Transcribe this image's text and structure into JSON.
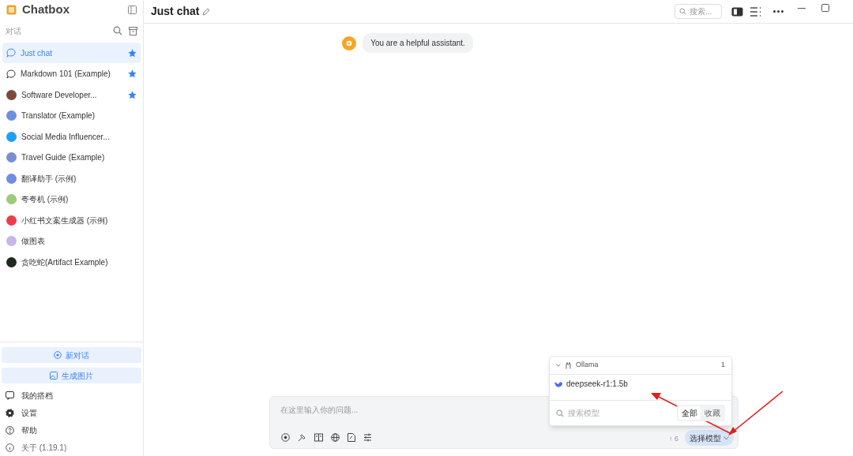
{
  "app": {
    "title": "Chatbox"
  },
  "sidebar": {
    "section_label": "对话",
    "items": [
      {
        "label": "Just chat",
        "kind": "chat",
        "selected": true,
        "starred": true
      },
      {
        "label": "Markdown 101 (Example)",
        "kind": "chat",
        "selected": false,
        "starred": true
      },
      {
        "label": "Software Developer...",
        "kind": "avatar",
        "color": "#7c4a3a",
        "selected": false,
        "starred": true
      },
      {
        "label": "Translator (Example)",
        "kind": "avatar",
        "color": "#6d8fe0",
        "selected": false,
        "starred": false
      },
      {
        "label": "Social Media Influencer...",
        "kind": "avatar",
        "color": "#1da1f2",
        "selected": false,
        "starred": false
      },
      {
        "label": "Travel Guide (Example)",
        "kind": "avatar",
        "color": "#7a8fd0",
        "selected": false,
        "starred": false
      },
      {
        "label": "翻译助手 (示例)",
        "kind": "avatar",
        "color": "#6d8fe0",
        "selected": false,
        "starred": false
      },
      {
        "label": "夸夸机 (示例)",
        "kind": "avatar",
        "color": "#9acd7a",
        "selected": false,
        "starred": false
      },
      {
        "label": "小红书文案生成器 (示例)",
        "kind": "avatar",
        "color": "#ef3b4b",
        "selected": false,
        "starred": false
      },
      {
        "label": "做图表",
        "kind": "avatar",
        "color": "#c7b6e8",
        "selected": false,
        "starred": false
      },
      {
        "label": "贪吃蛇(Artifact Example)",
        "kind": "avatar",
        "color": "#1f2a1f",
        "selected": false,
        "starred": false
      }
    ],
    "actions": [
      "新对话",
      "生成图片"
    ],
    "links": [
      {
        "label": "我的搭档",
        "kind": "partner"
      },
      {
        "label": "设置",
        "kind": "settings"
      },
      {
        "label": "帮助",
        "kind": "help"
      },
      {
        "label": "关于 (1.19.1)",
        "kind": "about"
      }
    ]
  },
  "header": {
    "title": "Just chat",
    "search_placeholder": "搜索..."
  },
  "messages": [
    {
      "kind": "system",
      "text": "You are a helpful assistant."
    }
  ],
  "composer": {
    "placeholder": "在这里输入你的问题...",
    "context_count": "↑ 6",
    "model_button": "选择模型"
  },
  "model_menu": {
    "provider": "Ollama",
    "count": "1",
    "models": [
      "deepseek-r1:1.5b"
    ],
    "search_placeholder": "搜索模型",
    "filters": [
      {
        "label": "全部",
        "selected": true
      },
      {
        "label": "收藏",
        "selected": false
      }
    ]
  }
}
